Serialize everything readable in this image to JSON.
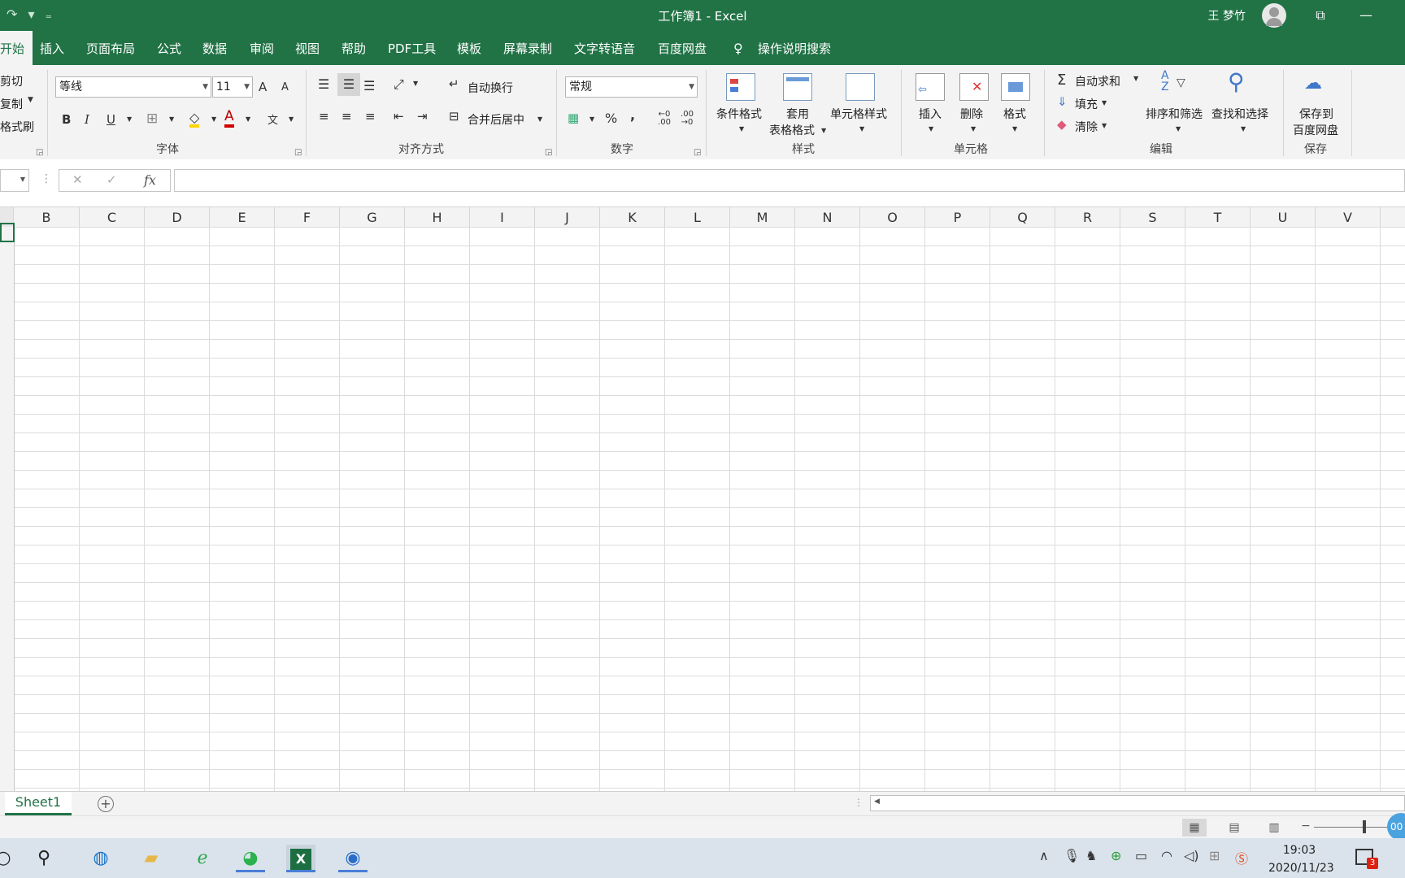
{
  "titlebar": {
    "quick_access": "↷ ▾ ₌",
    "title": "工作簿1  -  Excel",
    "user": "王 梦竹",
    "restore_glyph": "⧉",
    "minimize_glyph": "—"
  },
  "tabs": [
    {
      "label": "开始",
      "active": true
    },
    {
      "label": "插入"
    },
    {
      "label": "页面布局"
    },
    {
      "label": "公式"
    },
    {
      "label": "数据"
    },
    {
      "label": "审阅"
    },
    {
      "label": "视图"
    },
    {
      "label": "帮助"
    },
    {
      "label": "PDF工具"
    },
    {
      "label": "模板"
    },
    {
      "label": "屏幕录制"
    },
    {
      "label": "文字转语音"
    },
    {
      "label": "百度网盘"
    },
    {
      "label": "操作说明搜索"
    }
  ],
  "ribbon": {
    "clipboard": {
      "cut": "剪切",
      "copy": "复制",
      "painter": "格式刷"
    },
    "font": {
      "name": "等线",
      "size": "11",
      "group_label": "字体",
      "grow": "A",
      "shrink": "A",
      "bold": "B",
      "italic": "I",
      "underline": "U",
      "font_color_glyph": "A",
      "phonetic_glyph": "文"
    },
    "alignment": {
      "wrap": "自动换行",
      "merge": "合并后居中",
      "group_label": "对齐方式"
    },
    "number": {
      "format": "常规",
      "percent": "%",
      "comma": ",",
      "inc_dec": "←0\n.00",
      "dec_dec": ".00\n→0",
      "group_label": "数字"
    },
    "styles": {
      "conditional": "条件格式",
      "table_line1": "套用",
      "table_line2": "表格格式",
      "cell_styles": "单元格样式",
      "group_label": "样式"
    },
    "cells": {
      "insert": "插入",
      "delete": "删除",
      "format": "格式",
      "group_label": "单元格"
    },
    "editing": {
      "autosum": "自动求和",
      "fill": "填充",
      "clear": "清除",
      "sort_filter": "排序和筛选",
      "find_select": "查找和选择",
      "group_label": "编辑"
    },
    "save": {
      "line1": "保存到",
      "line2": "百度网盘",
      "group_label": "保存"
    }
  },
  "formula_bar": {
    "cancel": "✕",
    "enter": "✓",
    "fx": "fx",
    "value": ""
  },
  "columns": [
    "B",
    "C",
    "D",
    "E",
    "F",
    "G",
    "H",
    "I",
    "J",
    "K",
    "L",
    "M",
    "N",
    "O",
    "P",
    "Q",
    "R",
    "S",
    "T",
    "U",
    "V"
  ],
  "sheets": [
    {
      "name": "Sheet1",
      "active": true
    }
  ],
  "statusbar": {
    "zoom_badge": "00"
  },
  "taskbar": {
    "clock_time": "19:03",
    "clock_date": "2020/11/23",
    "notifications": "3"
  },
  "colors": {
    "accent": "#217346",
    "ribbon_bg": "#f3f3f3",
    "taskbar_bg": "#dae3ec"
  }
}
